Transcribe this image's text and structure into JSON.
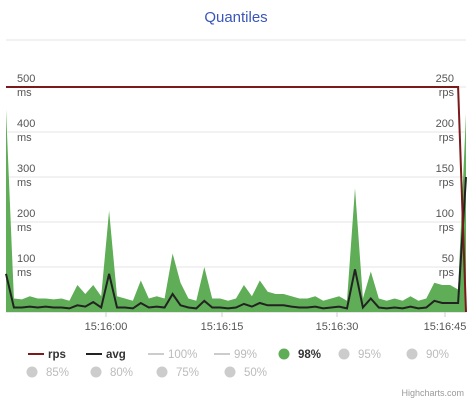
{
  "chart_data": {
    "type": "area",
    "title": "Quantiles",
    "x_ticks": [
      "15:16:00",
      "15:16:15",
      "15:16:30",
      "15:16:45"
    ],
    "y_left": {
      "ticks": [
        {
          "value": 100,
          "line1": "100",
          "line2": "ms"
        },
        {
          "value": 200,
          "line1": "200",
          "line2": "ms"
        },
        {
          "value": 300,
          "line1": "300",
          "line2": "ms"
        },
        {
          "value": 400,
          "line1": "400",
          "line2": "ms"
        },
        {
          "value": 500,
          "line1": "500",
          "line2": "ms"
        }
      ],
      "range": [
        0,
        500
      ]
    },
    "y_right": {
      "ticks": [
        {
          "value": 50,
          "line1": "50",
          "line2": "rps"
        },
        {
          "value": 100,
          "line1": "100",
          "line2": "rps"
        },
        {
          "value": 150,
          "line1": "150",
          "line2": "rps"
        },
        {
          "value": 200,
          "line1": "200",
          "line2": "rps"
        },
        {
          "value": 250,
          "line1": "250",
          "line2": "rps"
        }
      ],
      "range": [
        0,
        250
      ]
    },
    "grid": true,
    "series": [
      {
        "name": "98%",
        "axis": "ms",
        "visible": true,
        "color": "#5fad56",
        "values": [
          450,
          30,
          28,
          35,
          30,
          30,
          28,
          30,
          25,
          60,
          40,
          60,
          35,
          225,
          35,
          30,
          25,
          70,
          30,
          35,
          30,
          130,
          65,
          30,
          25,
          100,
          30,
          30,
          25,
          30,
          60,
          35,
          70,
          45,
          40,
          40,
          35,
          30,
          30,
          35,
          25,
          30,
          35,
          25,
          275,
          30,
          90,
          30,
          25,
          30,
          25,
          35,
          25,
          30,
          65,
          60,
          60,
          50,
          440
        ]
      },
      {
        "name": "avg",
        "axis": "ms",
        "visible": true,
        "color": "#222222",
        "values": [
          85,
          10,
          10,
          12,
          10,
          12,
          10,
          10,
          8,
          15,
          12,
          22,
          10,
          85,
          10,
          10,
          8,
          20,
          10,
          12,
          10,
          40,
          15,
          10,
          8,
          25,
          10,
          10,
          8,
          10,
          18,
          12,
          20,
          15,
          15,
          15,
          12,
          10,
          10,
          12,
          8,
          10,
          12,
          8,
          95,
          10,
          30,
          10,
          8,
          10,
          8,
          12,
          8,
          10,
          25,
          20,
          20,
          20,
          300
        ]
      },
      {
        "name": "rps",
        "axis": "rps",
        "visible": true,
        "color": "#7a1a1a",
        "values": [
          250,
          250,
          250,
          250,
          250,
          250,
          250,
          250,
          250,
          250,
          250,
          250,
          250,
          250,
          250,
          250,
          250,
          250,
          250,
          250,
          250,
          250,
          250,
          250,
          250,
          250,
          250,
          250,
          250,
          250,
          250,
          250,
          250,
          250,
          250,
          250,
          250,
          250,
          250,
          250,
          250,
          250,
          250,
          250,
          250,
          250,
          250,
          250,
          250,
          250,
          250,
          250,
          250,
          250,
          250,
          250,
          250,
          250,
          0
        ]
      }
    ],
    "legend": [
      {
        "name": "rps",
        "symbol": "line",
        "color": "#7a1a1a",
        "active": true
      },
      {
        "name": "avg",
        "symbol": "line",
        "color": "#222222",
        "active": true
      },
      {
        "name": "100%",
        "symbol": "line",
        "color": "#cccccc",
        "active": false
      },
      {
        "name": "99%",
        "symbol": "line",
        "color": "#cccccc",
        "active": false
      },
      {
        "name": "98%",
        "symbol": "dot",
        "color": "#5fad56",
        "active": true
      },
      {
        "name": "95%",
        "symbol": "dot",
        "color": "#cccccc",
        "active": false
      },
      {
        "name": "90%",
        "symbol": "dot",
        "color": "#cccccc",
        "active": false
      },
      {
        "name": "85%",
        "symbol": "dot",
        "color": "#cccccc",
        "active": false
      },
      {
        "name": "80%",
        "symbol": "dot",
        "color": "#cccccc",
        "active": false
      },
      {
        "name": "75%",
        "symbol": "dot",
        "color": "#cccccc",
        "active": false
      },
      {
        "name": "50%",
        "symbol": "dot",
        "color": "#cccccc",
        "active": false
      }
    ],
    "credits": "Highcharts.com"
  }
}
